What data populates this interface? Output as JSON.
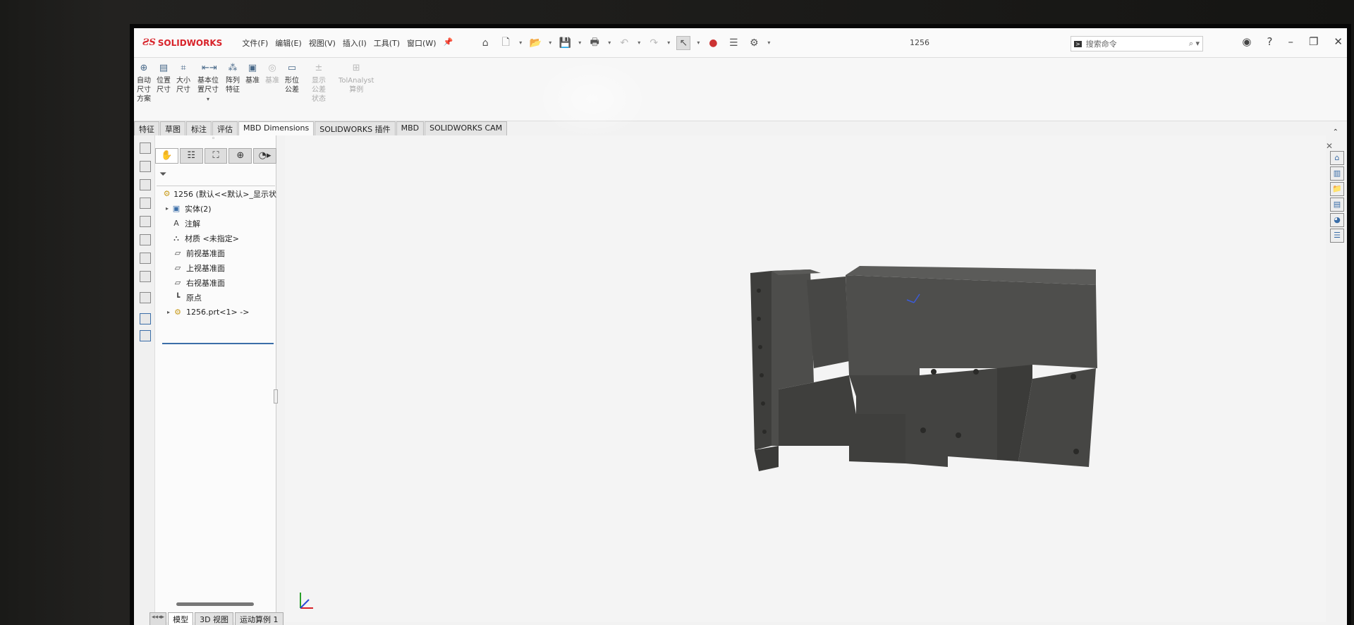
{
  "app": {
    "logo_ds": "ƧS",
    "logo_text": "SOLIDWORKS",
    "doc_title": "1256"
  },
  "menus": [
    "文件(F)",
    "编辑(E)",
    "视图(V)",
    "插入(I)",
    "工具(T)",
    "窗口(W)"
  ],
  "search": {
    "placeholder": "搜索命令"
  },
  "commands": [
    {
      "line1": "自动",
      "line2": "尺寸",
      "line3": "方案",
      "icon": "auto-dim-icon",
      "enabled": true
    },
    {
      "line1": "位置",
      "line2": "尺寸",
      "line3": "",
      "icon": "location-dim-icon",
      "enabled": true
    },
    {
      "line1": "大小",
      "line2": "尺寸",
      "line3": "",
      "icon": "size-dim-icon",
      "enabled": true
    },
    {
      "line1": "基本位",
      "line2": "置尺寸",
      "line3": "",
      "icon": "basic-location-dim-icon",
      "enabled": true
    },
    {
      "line1": "阵列",
      "line2": "特征",
      "line3": "",
      "icon": "pattern-feature-icon",
      "enabled": true
    },
    {
      "line1": "基准",
      "line2": "",
      "line3": "",
      "icon": "datum-icon",
      "enabled": true
    },
    {
      "line1": "基准",
      "line2": "",
      "line3": "",
      "icon": "datum-target-icon",
      "enabled": false
    },
    {
      "line1": "形位",
      "line2": "公差",
      "line3": "",
      "icon": "geometric-tolerance-icon",
      "enabled": true
    },
    {
      "line1": "显示",
      "line2": "公差",
      "line3": "状态",
      "icon": "show-tolerance-icon",
      "enabled": false
    },
    {
      "line1": "TolAnalyst",
      "line2": "算例",
      "line3": "",
      "icon": "tolanalyst-icon",
      "enabled": false
    }
  ],
  "tabs": [
    {
      "label": "特征",
      "active": false
    },
    {
      "label": "草图",
      "active": false
    },
    {
      "label": "标注",
      "active": false
    },
    {
      "label": "评估",
      "active": false
    },
    {
      "label": "MBD Dimensions",
      "active": true
    },
    {
      "label": "SOLIDWORKS 插件",
      "active": false
    },
    {
      "label": "MBD",
      "active": false
    },
    {
      "label": "SOLIDWORKS CAM",
      "active": false
    }
  ],
  "tree": [
    {
      "label": "1256  (默认<<默认>_显示状",
      "icon": "part-icon",
      "expand": "",
      "indent": 0
    },
    {
      "label": "实体(2)",
      "icon": "solid-bodies-icon",
      "expand": "▸",
      "indent": 1
    },
    {
      "label": "注解",
      "icon": "annotations-icon",
      "expand": "",
      "indent": 1
    },
    {
      "label": "材质 <未指定>",
      "icon": "material-icon",
      "expand": "",
      "indent": 1
    },
    {
      "label": "前视基准面",
      "icon": "plane-icon",
      "expand": "",
      "indent": 1
    },
    {
      "label": "上视基准面",
      "icon": "plane-icon",
      "expand": "",
      "indent": 1
    },
    {
      "label": "右视基准面",
      "icon": "plane-icon",
      "expand": "",
      "indent": 1
    },
    {
      "label": "原点",
      "icon": "origin-icon",
      "expand": "",
      "indent": 1
    },
    {
      "label": "1256.prt<1> ->",
      "icon": "part-icon",
      "expand": "▸",
      "indent": 1
    }
  ],
  "bottom_tabs": [
    {
      "label": "模型",
      "active": true
    },
    {
      "label": "3D 视图",
      "active": false
    },
    {
      "label": "运动算例 1",
      "active": false
    }
  ],
  "colors": {
    "accent": "#3b6ea8",
    "brand": "#d8232a",
    "model": "#4a4a48"
  }
}
